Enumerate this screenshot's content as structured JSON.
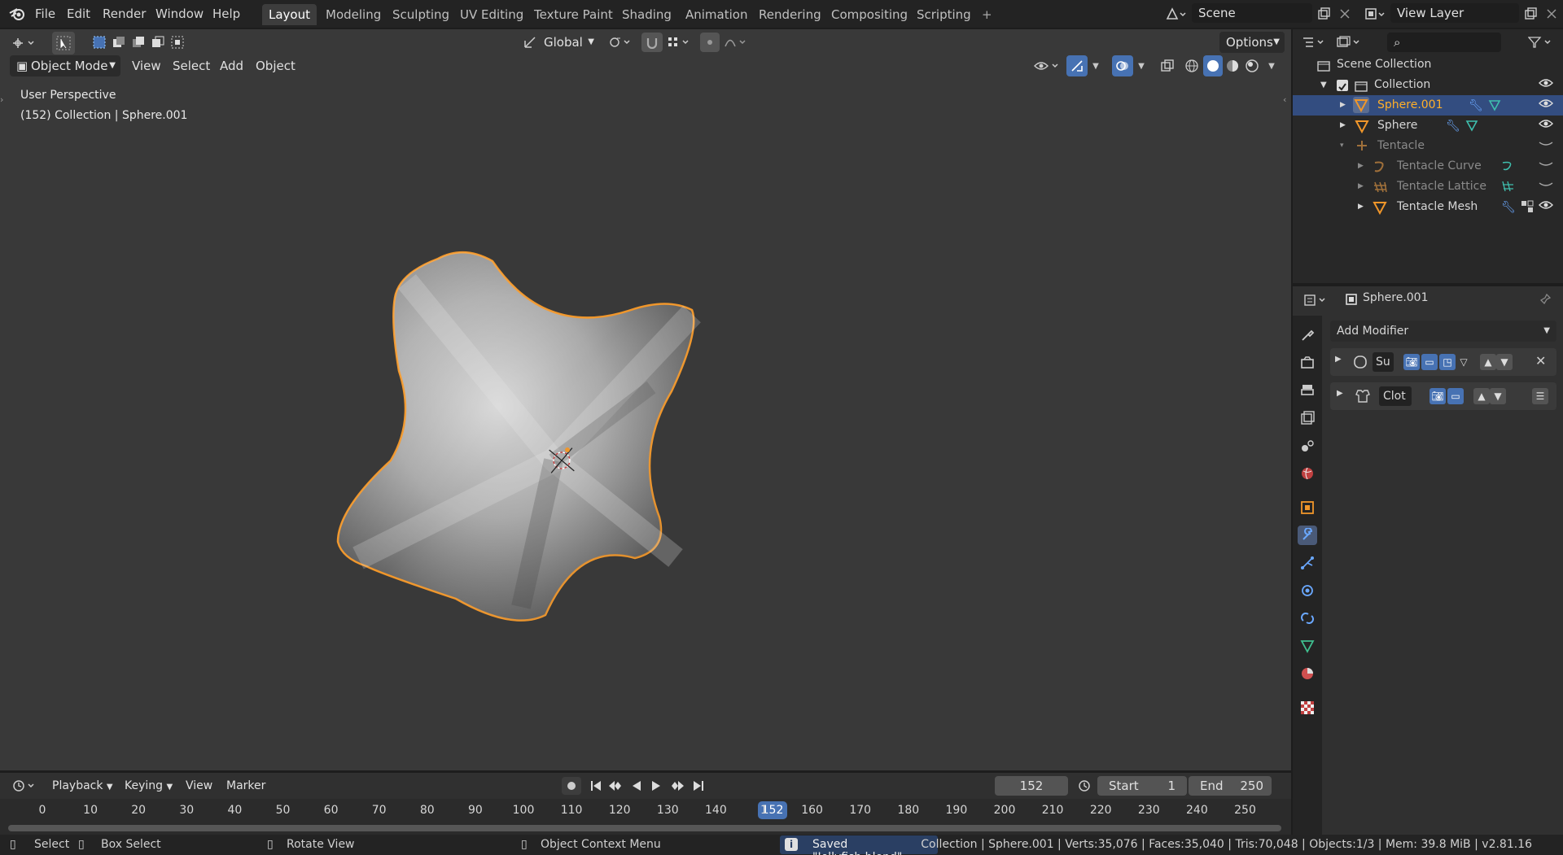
{
  "menu": {
    "items": [
      "File",
      "Edit",
      "Render",
      "Window",
      "Help"
    ]
  },
  "workspaces": {
    "tabs": [
      "Layout",
      "Modeling",
      "Sculpting",
      "UV Editing",
      "Texture Paint",
      "Shading",
      "Animation",
      "Rendering",
      "Compositing",
      "Scripting"
    ],
    "active": "Layout",
    "add": "+"
  },
  "scene": {
    "name": "Scene"
  },
  "view_layer": {
    "name": "View Layer"
  },
  "viewport": {
    "transform_orientation": "Global",
    "options_label": "Options",
    "mode": "Object Mode",
    "header_menus": [
      "View",
      "Select",
      "Add",
      "Object"
    ],
    "overlay_line1": "User Perspective",
    "overlay_line2": "(152) Collection | Sphere.001",
    "selection_color": "#f0962a",
    "object": "Sphere.001"
  },
  "outliner": {
    "rows": [
      {
        "label": "Scene Collection",
        "icon": "scene-collection-icon"
      },
      {
        "label": "Collection",
        "icon": "collection-icon"
      },
      {
        "label": "Sphere.001",
        "icon": "mesh-icon"
      },
      {
        "label": "Sphere",
        "icon": "mesh-icon"
      },
      {
        "label": "Tentacle",
        "icon": "armature-icon"
      },
      {
        "label": "Tentacle Curve",
        "icon": "curve-icon"
      },
      {
        "label": "Tentacle Lattice",
        "icon": "lattice-icon"
      },
      {
        "label": "Tentacle Mesh",
        "icon": "mesh-icon"
      }
    ]
  },
  "properties": {
    "object_name": "Sphere.001",
    "add_modifier": "Add Modifier",
    "modifiers": [
      {
        "short_name": "Su",
        "icon": "subdivision-icon"
      },
      {
        "short_name": "Clot",
        "icon": "cloth-icon"
      }
    ]
  },
  "timeline": {
    "menus": [
      "Playback",
      "Keying",
      "View",
      "Marker"
    ],
    "current_frame": "152",
    "start_label": "Start",
    "start_value": "1",
    "end_label": "End",
    "end_value": "250",
    "ticks": [
      "0",
      "10",
      "20",
      "30",
      "40",
      "50",
      "60",
      "70",
      "80",
      "90",
      "100",
      "110",
      "120",
      "130",
      "140",
      "1",
      "160",
      "170",
      "180",
      "190",
      "200",
      "210",
      "220",
      "230",
      "240",
      "250"
    ],
    "playhead_label": "152"
  },
  "status": {
    "select": "Select",
    "box_select": "Box Select",
    "rotate_view": "Rotate View",
    "context_menu": "Object Context Menu",
    "saved_message": "Saved \"Jellyfish.blend\"",
    "stats": "Collection | Sphere.001 | Verts:35,076 | Faces:35,040 | Tris:70,048 | Objects:1/3 | Mem: 39.8 MiB | v2.81.16"
  }
}
